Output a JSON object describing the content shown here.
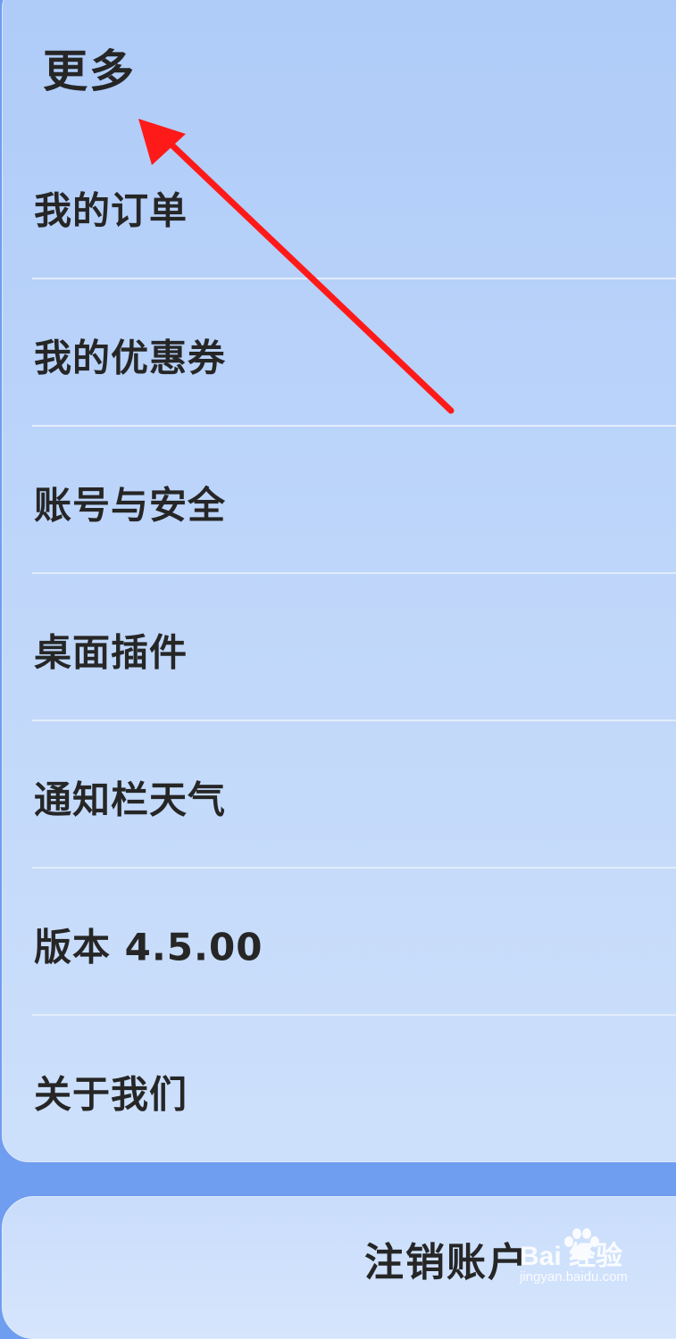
{
  "section": {
    "title": "更多"
  },
  "menu": {
    "items": [
      {
        "label": "我的订单"
      },
      {
        "label": "我的优惠券"
      },
      {
        "label": "账号与安全"
      },
      {
        "label": "桌面插件"
      },
      {
        "label": "通知栏天气"
      },
      {
        "label": "版本 4.5.00"
      },
      {
        "label": "关于我们"
      }
    ]
  },
  "logout": {
    "label": "注销账户"
  },
  "watermark": {
    "brand": "Bai  经验",
    "url": "jingyan.baidu.com"
  },
  "colors": {
    "background": "#6f9df0",
    "card_top": "#aecbf8",
    "card_bottom": "#cde0fb",
    "annotation_arrow": "#ff1a1a"
  },
  "icons": {
    "annotation": "red-arrow-icon",
    "watermark": "baidu-paw-icon"
  }
}
